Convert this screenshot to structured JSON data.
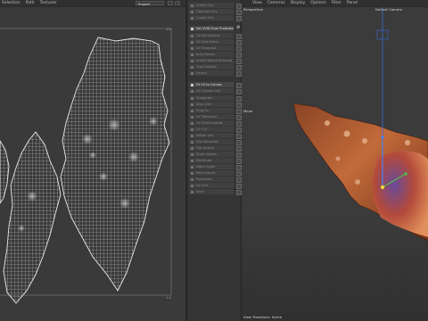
{
  "uv_editor": {
    "menu": [
      "Selection",
      "Path",
      "Textures"
    ],
    "projection_dropdown": "Project",
    "corner_top_right": "1.0",
    "corner_bottom_right": "1.0"
  },
  "toolbox": {
    "items": [
      {
        "label": "Unfold UVs",
        "active": false
      },
      {
        "label": "Optimize UVs",
        "active": false
      },
      {
        "label": "Create UVs",
        "active": false
      },
      {
        "label": "Set UVW From Projection",
        "active": true,
        "gear": true
      },
      {
        "label": "UV Set Options",
        "active": false
      },
      {
        "label": "UV Sets Editor",
        "active": false
      },
      {
        "label": "UV Snapshot",
        "active": false
      },
      {
        "label": "Auto Seams",
        "active": false
      },
      {
        "label": "Unfold Before Relaxing",
        "active": false
      },
      {
        "label": "Texel Density",
        "active": false
      },
      {
        "label": "Layout",
        "active": false
      },
      {
        "label": "Fit UV to Canvas",
        "active": true
      },
      {
        "label": "UV Canvas Grid",
        "active": false
      },
      {
        "label": "Straighten",
        "active": false
      },
      {
        "label": "Align UVs",
        "active": false
      },
      {
        "label": "Snap To",
        "active": false
      },
      {
        "label": "UV Transform",
        "active": false
      },
      {
        "label": "UV Stitch Islands",
        "active": false
      },
      {
        "label": "UV Cut",
        "active": false
      },
      {
        "label": "Rotate UVs",
        "active": false
      },
      {
        "label": "Flip Horizontal",
        "active": false
      },
      {
        "label": "Flip Vertical",
        "active": false
      },
      {
        "label": "Stack Islands",
        "active": false
      },
      {
        "label": "Distribute",
        "active": false
      },
      {
        "label": "Match Scale",
        "active": false
      },
      {
        "label": "Pack Islands",
        "active": false
      },
      {
        "label": "Normalize",
        "active": false
      },
      {
        "label": "UV Grid",
        "active": false
      },
      {
        "label": "Shell",
        "active": false
      }
    ]
  },
  "viewport": {
    "menu": [
      "View",
      "Cameras",
      "Display",
      "Options",
      "Filter",
      "Panel"
    ],
    "view_label": "Perspective",
    "camera_label": "Default Camera",
    "move_label": "Move",
    "status_label": "View Transform: Scene"
  },
  "colors": {
    "uv_background": "#3a3a3a",
    "uv_wire": "#d8d8d8",
    "viewport_background": "#3b3b3b",
    "shell_orange": "#c06a3a",
    "gizmo_blue": "#3a6bd8",
    "gizmo_green": "#4bbf4b"
  }
}
